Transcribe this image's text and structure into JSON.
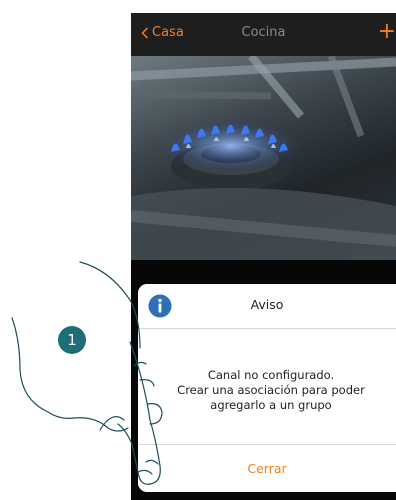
{
  "nav": {
    "back_label": "Casa",
    "title": "Cocina",
    "add_label": "+"
  },
  "dialog": {
    "title": "Aviso",
    "message_lines": [
      "Canal no configurado.",
      "Crear una asociación para poder",
      "agregarlo a un grupo"
    ],
    "button_label": "Cerrar"
  },
  "annotation": {
    "step_number": "1"
  },
  "icons": {
    "back": "chevron-left-icon",
    "info": "info-icon",
    "add": "plus-icon"
  },
  "colors": {
    "accent": "#f07f1f",
    "info_blue": "#2f6fb5",
    "step_badge": "#1f6d77"
  }
}
